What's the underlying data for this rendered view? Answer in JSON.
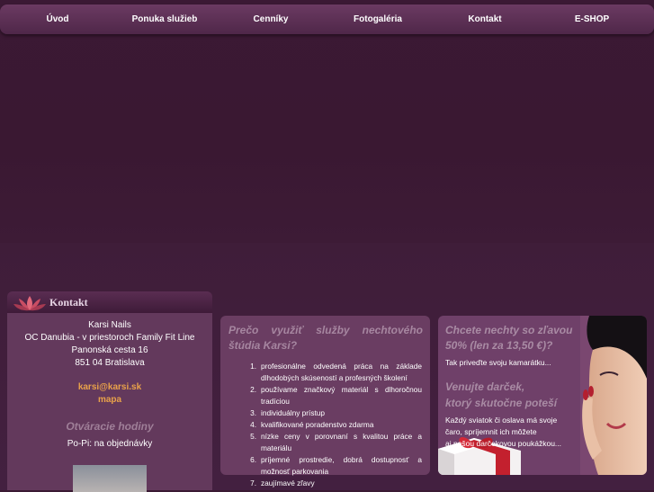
{
  "nav": {
    "items": [
      {
        "label": "Úvod"
      },
      {
        "label": "Ponuka služieb"
      },
      {
        "label": "Cenníky"
      },
      {
        "label": "Fotogaléria"
      },
      {
        "label": "Kontakt"
      },
      {
        "label": "E-SHOP"
      }
    ]
  },
  "contact": {
    "title": "Kontakt",
    "name": "Karsi Nails",
    "location": "OC Danubia - v priestoroch Family Fit Line",
    "street": "Panonská cesta 16",
    "city": "851 04 Bratislava",
    "email": "karsi@karsi.sk",
    "map_link": "mapa",
    "hours_title": "Otváracie hodiny",
    "hours_text": "Po-Pi: na objednávky"
  },
  "why": {
    "title_line1_words": [
      "Prečo",
      "využiť",
      "služby",
      "nechtového"
    ],
    "title_line2": "štúdia Karsi?",
    "items": [
      {
        "num": "1.",
        "text": "profesionálne odvedená práca na základe dlhodobých skúseností a profesných školení"
      },
      {
        "num": "2.",
        "text": "používame značkový materiál s dlhoročnou tradíciou"
      },
      {
        "num": "3.",
        "text": "individuálny prístup"
      },
      {
        "num": "4.",
        "text": "kvalifikované poradenstvo zdarma"
      },
      {
        "num": "5.",
        "text": "nízke ceny v porovnaní s kvalitou práce a materiálu"
      },
      {
        "num": "6.",
        "text": "príjemné prostredie, dobrá dostupnosť a možnosť parkovania"
      },
      {
        "num": "7.",
        "text": "zaujímavé zľavy"
      }
    ]
  },
  "promo": {
    "heading1_line1": "Chcete nechty so zľavou",
    "heading1_line2": "50% (len za 13,50 €)?",
    "text1": "Tak priveďte svoju kamarátku...",
    "heading2_line1": "Venujte darček,",
    "heading2_line2": "ktorý skutočne poteší",
    "text2_line1": "Každý sviatok či oslava má svoje",
    "text2_line2": "čaro, spríjemnit ich môžete",
    "text2_line3": "aj našou darčekovou poukážkou..."
  },
  "colors": {
    "background": "#3a1a33",
    "panel": "#6a3d62",
    "accent_orange": "#e9a24a",
    "heading_mauve": "#a686a0"
  }
}
